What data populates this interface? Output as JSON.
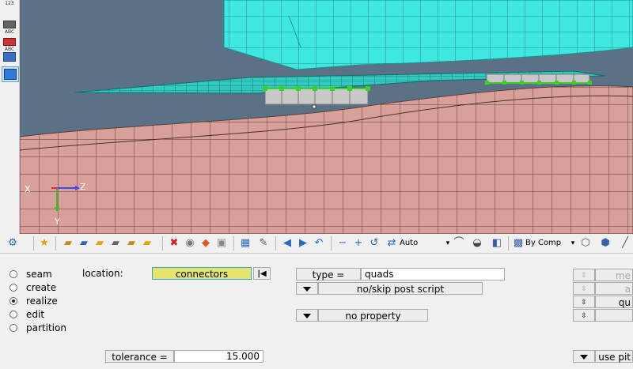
{
  "left_toolbar": {
    "items": [
      {
        "label": "123",
        "icon": "numbers-icon"
      },
      {
        "label": "ABC",
        "icon": "label-abc-icon"
      },
      {
        "label": "ABC",
        "icon": "label-abc-red-icon"
      },
      {
        "label": "",
        "icon": "component-tool-icon"
      },
      {
        "label": "",
        "icon": "blue-box-icon",
        "selected": true
      }
    ]
  },
  "viewport": {
    "axis": {
      "x_label": "X",
      "z_label": "Z",
      "y_label": "Y"
    },
    "colors": {
      "background": "#5a7186",
      "upper_part": "#3ee8e0",
      "lower_part": "#d9a09a",
      "connector": "#3cd12a",
      "weld_block": "#c8c8c8"
    }
  },
  "toolbar": {
    "auto_label": "Auto",
    "bycomp_label": "By Comp"
  },
  "panel": {
    "radios": [
      {
        "label": "seam",
        "checked": false
      },
      {
        "label": "create",
        "checked": false
      },
      {
        "label": "realize",
        "checked": true
      },
      {
        "label": "edit",
        "checked": false
      },
      {
        "label": "partition",
        "checked": false
      }
    ],
    "location_label": "location:",
    "location_value": "connectors",
    "type_button": "type =",
    "type_value": "quads",
    "post_script": "no/skip post script",
    "property": "no property",
    "tolerance_label": "tolerance =",
    "tolerance_value": "15.000",
    "right_col": [
      "me",
      "a",
      "qu",
      "",
      "use pit"
    ]
  }
}
